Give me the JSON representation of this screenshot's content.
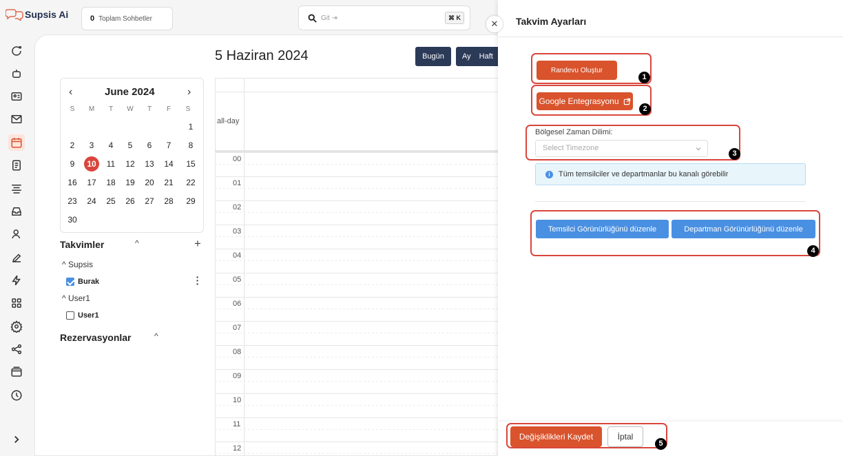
{
  "app": {
    "name": "Supsis Ai"
  },
  "header": {
    "chat_count": "0",
    "chat_count_label": "Toplam Sohbetler",
    "search_placeholder": "Git ⇥",
    "search_shortcut": "⌘ K"
  },
  "calendar": {
    "date_title": "5 Haziran 2024",
    "today_button": "Bugün",
    "view_month": "Ay",
    "view_week": "Haft",
    "all_day": "all-day",
    "hours": [
      "00",
      "01",
      "02",
      "03",
      "04",
      "05",
      "06",
      "07",
      "08",
      "09",
      "10",
      "11",
      "12"
    ]
  },
  "mini_calendar": {
    "month_label": "June 2024",
    "prev": "‹",
    "next": "›",
    "weekdays": [
      "S",
      "M",
      "T",
      "W",
      "T",
      "F",
      "S"
    ],
    "weeks": [
      [
        "",
        "",
        "",
        "",
        "",
        "",
        "1"
      ],
      [
        "2",
        "3",
        "4",
        "5",
        "6",
        "7",
        "8"
      ],
      [
        "9",
        "10",
        "11",
        "12",
        "13",
        "14",
        "15"
      ],
      [
        "16",
        "17",
        "18",
        "19",
        "20",
        "21",
        "22"
      ],
      [
        "23",
        "24",
        "25",
        "26",
        "27",
        "28",
        "29"
      ],
      [
        "30",
        "",
        "",
        "",
        "",
        "",
        ""
      ]
    ],
    "today": "10"
  },
  "sidebar": {
    "calendars_title": "Takvimler",
    "add": "+",
    "groups": [
      {
        "name": "Supsis",
        "items": [
          {
            "label": "Burak",
            "checked": true
          }
        ]
      },
      {
        "name": "User1",
        "items": [
          {
            "label": "User1",
            "checked": false
          }
        ]
      }
    ],
    "reservations_title": "Rezervasyonlar"
  },
  "drawer": {
    "title": "Takvim Ayarları",
    "create_appointment": "Randevu Oluştur",
    "google_integration": "Google Entegrasyonu",
    "timezone_label": "Bölgesel Zaman Dilimi:",
    "timezone_placeholder": "Select Timezone",
    "info_text": "Tüm temsilciler ve departmanlar bu kanalı görebilir",
    "edit_agent_visibility": "Temsilci Görünürlüğünü düzenle",
    "edit_department_visibility": "Departman Görünürlüğünü düzenle",
    "save": "Değişiklikleri Kaydet",
    "cancel": "İptal",
    "badges": [
      "1",
      "2",
      "3",
      "4",
      "5"
    ]
  },
  "colors": {
    "accent": "#d9532c",
    "annotation_red": "#d9453c",
    "primary_blue": "#4a90e2",
    "dark_button": "#2b3a57"
  }
}
